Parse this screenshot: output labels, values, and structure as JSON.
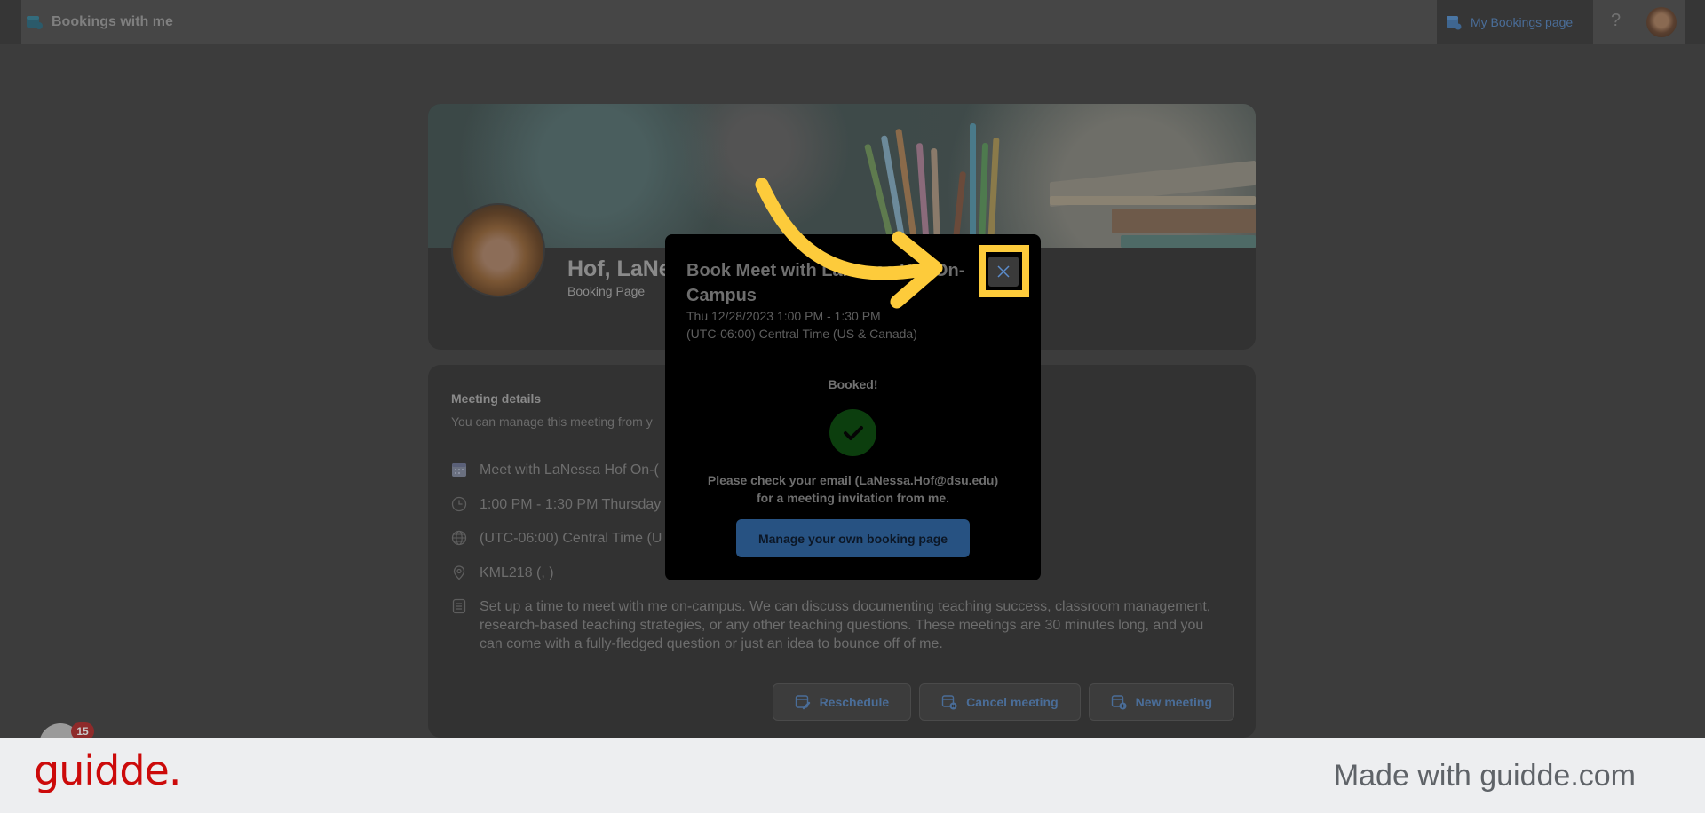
{
  "app": {
    "title": "Bookings with me",
    "my_bookings_label": "My Bookings page",
    "help_label": "?"
  },
  "profile": {
    "name": "Hof, LaNe",
    "subtitle": "Booking Page"
  },
  "details": {
    "title": "Meeting details",
    "subtitle": "You can manage this meeting from y",
    "rows": [
      {
        "icon": "calendar-icon",
        "text": "Meet with LaNessa Hof On-("
      },
      {
        "icon": "clock-icon",
        "text": "1:00 PM - 1:30 PM Thursday"
      },
      {
        "icon": "globe-icon",
        "text": "(UTC-06:00) Central Time (U"
      },
      {
        "icon": "location-icon",
        "text": "KML218 (, )"
      },
      {
        "icon": "notes-icon",
        "text": "Set up a time to meet with me on-campus. We can discuss documenting teaching success, classroom management, research-based teaching strategies, or any other teaching questions. These meetings are 30 minutes long, and you can come with a fully-fledged question or just an idea to bounce off of me."
      }
    ],
    "actions": {
      "reschedule": "Reschedule",
      "cancel": "Cancel meeting",
      "new": "New meeting"
    }
  },
  "modal": {
    "title": "Book Meet with LaNessa Hof On-Campus",
    "datetime": "Thu 12/28/2023 1:00 PM - 1:30 PM",
    "timezone": "(UTC-06:00) Central Time (US & Canada)",
    "status": "Booked!",
    "message_line1": "Please check your email (LaNessa.Hof@dsu.edu)",
    "message_line2": "for a meeting invitation from me.",
    "manage_button": "Manage your own booking page",
    "close_label": "×"
  },
  "widget": {
    "badge_count": "15"
  },
  "footer": {
    "logo": "guidde.",
    "tagline": "Made with guidde.com"
  },
  "colors": {
    "accent": "#4a6d98",
    "highlight": "#fdcb3b",
    "success": "#0c3e0e",
    "brand": "#cc0a0a"
  }
}
